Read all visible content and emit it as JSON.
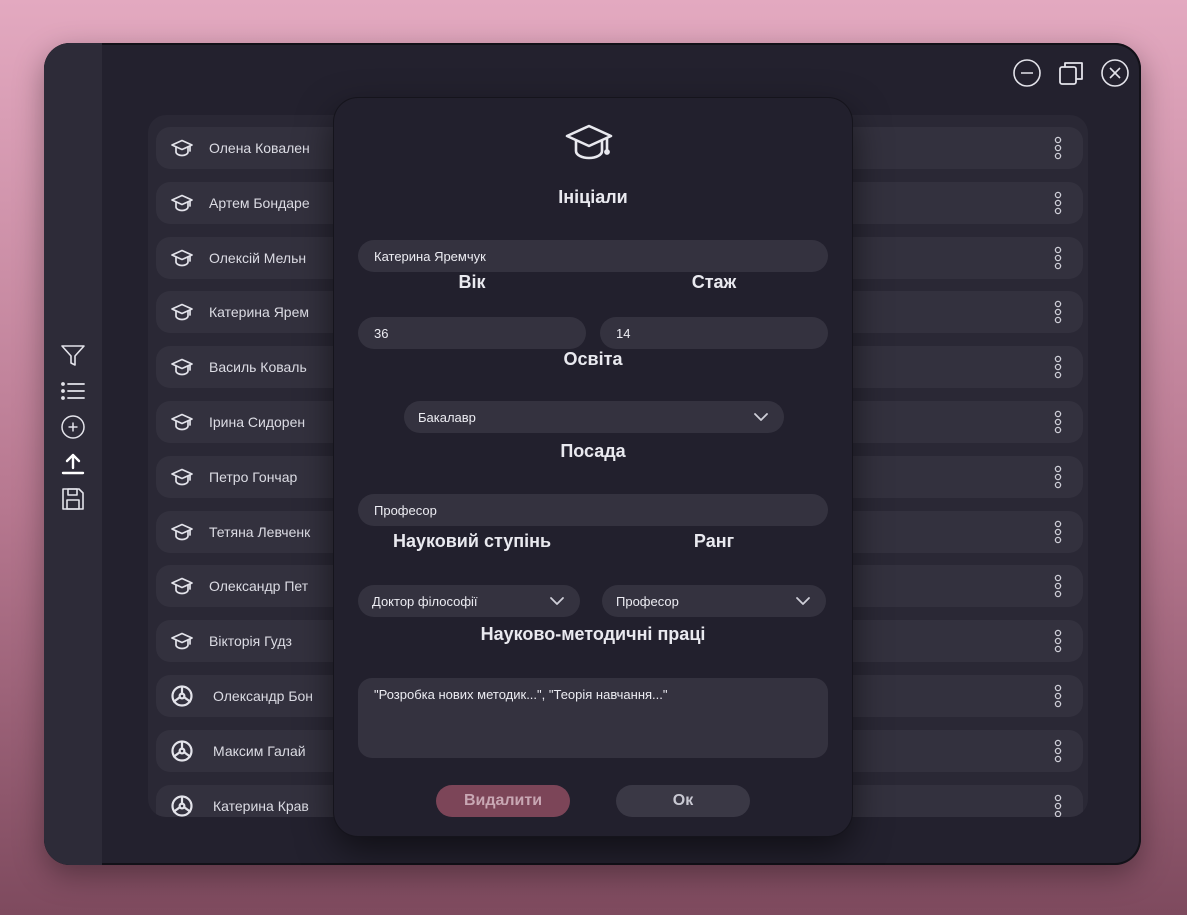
{
  "theme": {
    "accent": "#7c4558",
    "icon_color": "#e3e3ea"
  },
  "window_controls": {
    "minimize_icon": "minus-circle-icon",
    "restore_icon": "restore-icon",
    "close_icon": "close-circle-icon"
  },
  "sidebar": {
    "items": [
      {
        "name": "filter",
        "icon": "filter-icon"
      },
      {
        "name": "list",
        "icon": "list-icon"
      },
      {
        "name": "add",
        "icon": "plus-circle-icon"
      },
      {
        "name": "upload",
        "icon": "upload-icon"
      },
      {
        "name": "save",
        "icon": "save-icon"
      }
    ]
  },
  "list": {
    "items": [
      {
        "name": "Олена Ковален",
        "icon": "graduation-cap-icon"
      },
      {
        "name": "Артем Бондаре",
        "icon": "graduation-cap-icon"
      },
      {
        "name": "Олексій Мельн",
        "icon": "graduation-cap-icon"
      },
      {
        "name": "Катерина Ярем",
        "icon": "graduation-cap-icon"
      },
      {
        "name": "Василь Коваль",
        "icon": "graduation-cap-icon"
      },
      {
        "name": "Ірина Сидорен",
        "icon": "graduation-cap-icon"
      },
      {
        "name": "Петро Гончар",
        "icon": "graduation-cap-icon"
      },
      {
        "name": "Тетяна Левченк",
        "icon": "graduation-cap-icon"
      },
      {
        "name": "Олександр Пет",
        "icon": "graduation-cap-icon"
      },
      {
        "name": "Вікторія Гудз",
        "icon": "graduation-cap-icon"
      },
      {
        "name": "Олександр Бон",
        "icon": "steering-wheel-icon"
      },
      {
        "name": "Максим Галай",
        "icon": "steering-wheel-icon"
      },
      {
        "name": "Катерина Крав",
        "icon": "steering-wheel-icon"
      }
    ],
    "more_icon": "more-vertical-icon"
  },
  "dialog": {
    "header_icon": "graduation-cap-icon",
    "initials_label": "Ініціали",
    "initials_value": "Катерина Яремчук",
    "age_label": "Вік",
    "age_value": "36",
    "experience_label": "Стаж",
    "experience_value": "14",
    "education_label": "Освіта",
    "education_value": "Бакалавр",
    "position_label": "Посада",
    "position_value": "Професор",
    "degree_label": "Науковий ступінь",
    "degree_value": "Доктор філософії",
    "rank_label": "Ранг",
    "rank_value": "Професор",
    "works_label": "Науково-методичні праці",
    "works_value": "\"Розробка нових методик...\", \"Теорія навчання...\"",
    "delete_label": "Видалити",
    "ok_label": "Ок"
  }
}
